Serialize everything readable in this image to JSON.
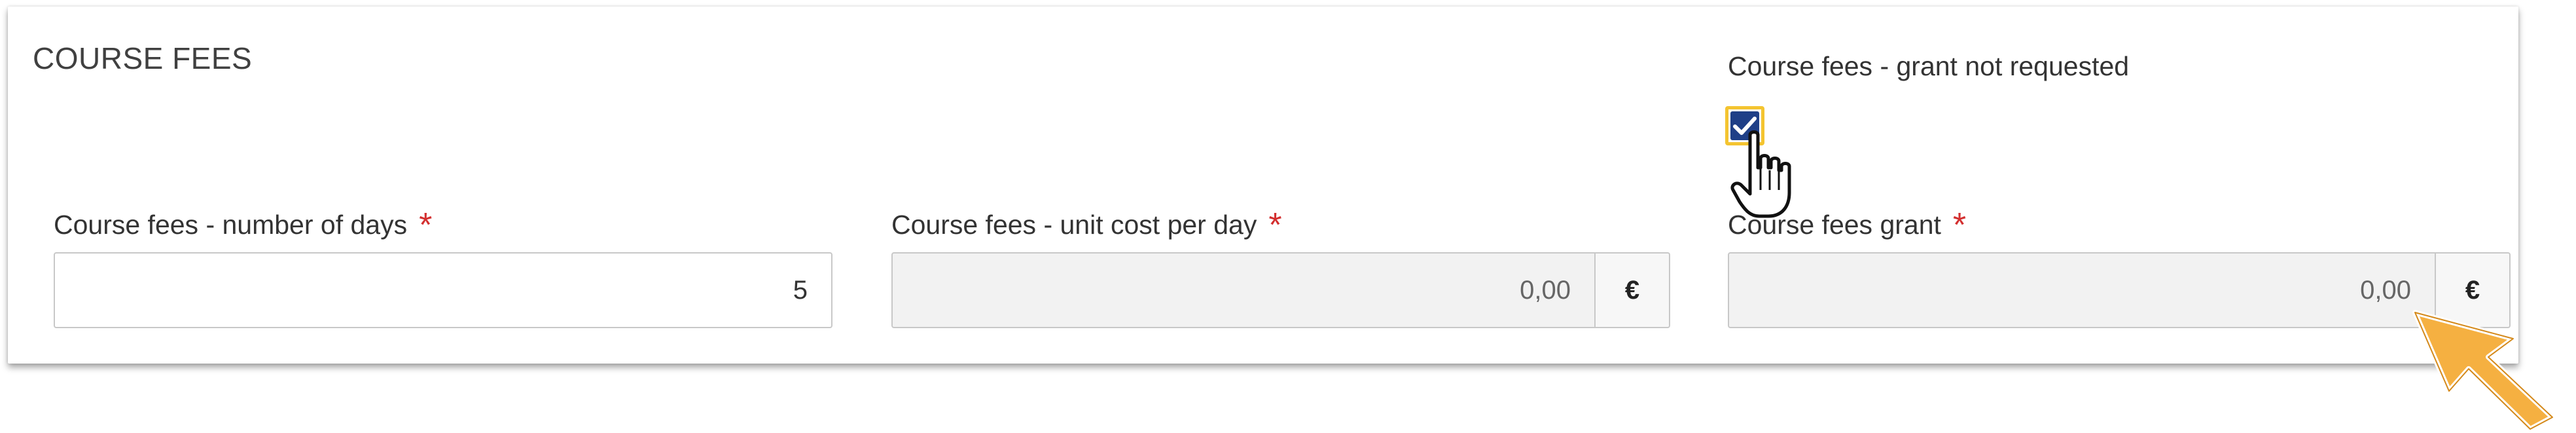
{
  "section": {
    "title": "COURSE FEES"
  },
  "fields": {
    "days": {
      "label": "Course fees - number of days",
      "required_mark": "*",
      "value": "5"
    },
    "unit_cost": {
      "label": "Course fees - unit cost per day",
      "required_mark": "*",
      "value": "0,00",
      "currency": "€"
    },
    "grant_not_requested": {
      "label": "Course fees - grant not requested",
      "checked": true
    },
    "grant": {
      "label": "Course fees grant",
      "required_mark": "*",
      "value": "0,00",
      "currency": "€"
    }
  },
  "icons": {
    "checkbox": "checkmark-icon",
    "cursor": "hand-pointer-icon",
    "annotation": "arrow-pointer-icon"
  },
  "colors": {
    "checkbox_fill": "#1f3f87",
    "checkbox_highlight": "#f4c430",
    "required": "#d32f2f",
    "annotation_arrow": "#f5b041"
  }
}
